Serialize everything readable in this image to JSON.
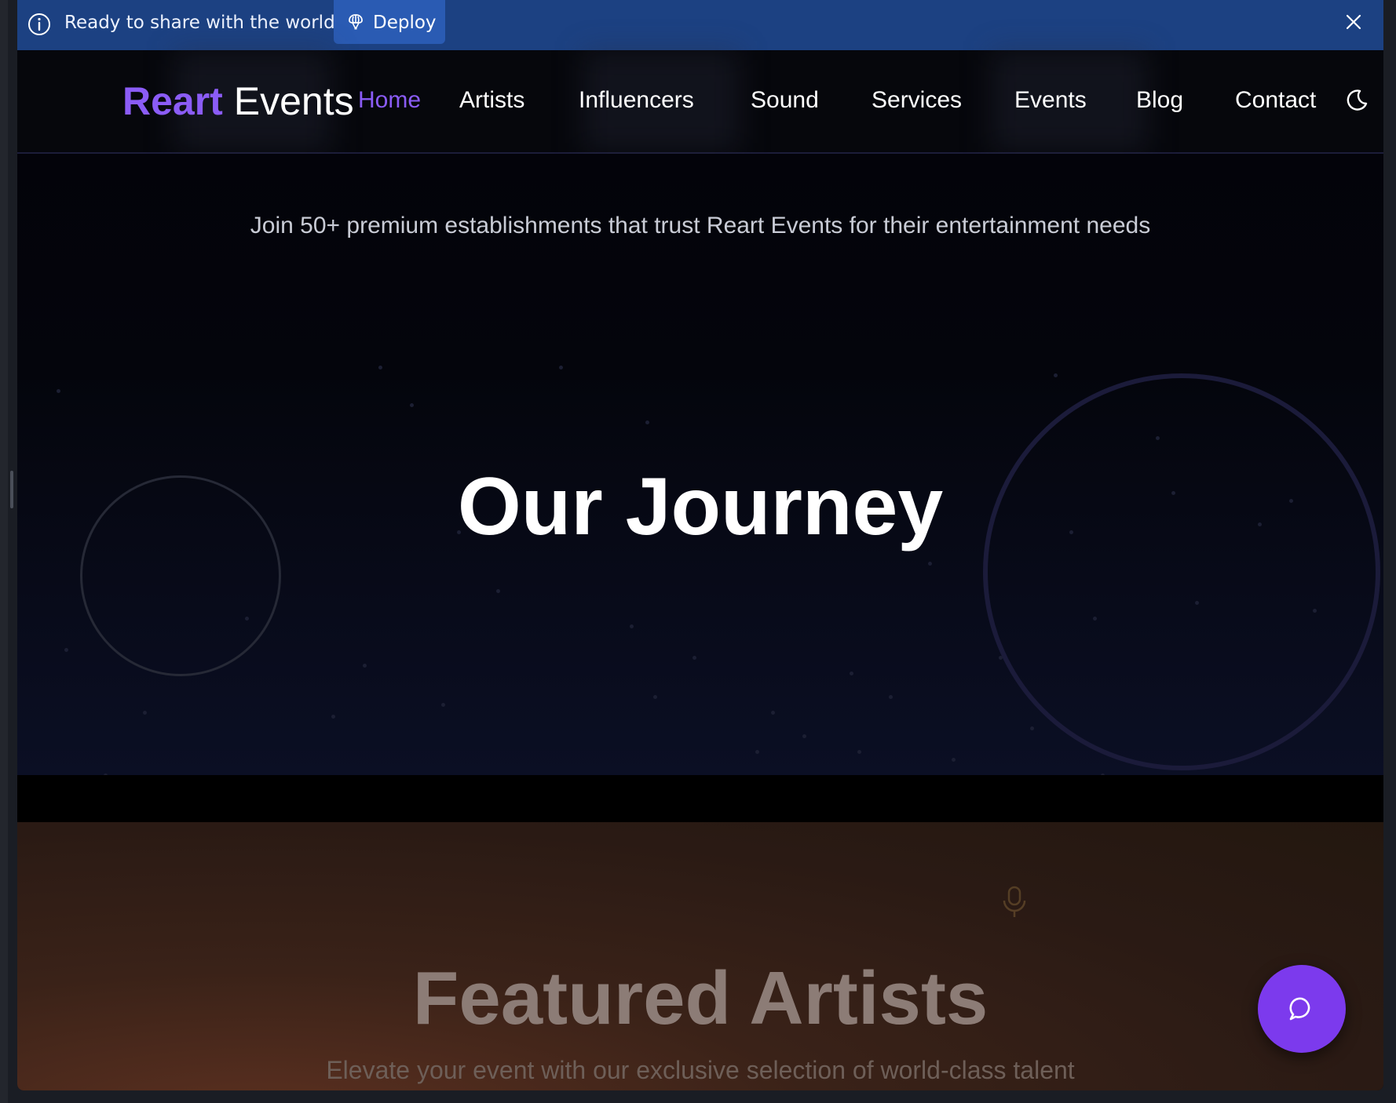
{
  "banner": {
    "message": "Ready to share with the world?",
    "deploy_label": "Deploy"
  },
  "nav": {
    "logo_primary": "Reart",
    "logo_secondary": "Events",
    "links": [
      "Home",
      "Artists",
      "Influencers",
      "Sound",
      "Services",
      "Events",
      "Blog",
      "Contact"
    ],
    "active": "Home"
  },
  "hero": {
    "tagline": "Join 50+ premium establishments that trust Reart Events for their entertainment needs",
    "title": "Our Journey"
  },
  "featured": {
    "title": "Featured Artists",
    "subtitle": "Elevate your event with our exclusive selection of world-class talent"
  },
  "icons": {
    "info": "info-icon",
    "deploy": "deploy-icon",
    "close": "close-icon",
    "theme": "moon-icon",
    "mic": "microphone-icon",
    "chat": "chat-icon"
  },
  "colors": {
    "banner_bg": "#1c4182",
    "accent": "#8b5cf6",
    "chat_button": "#7c3aed"
  }
}
